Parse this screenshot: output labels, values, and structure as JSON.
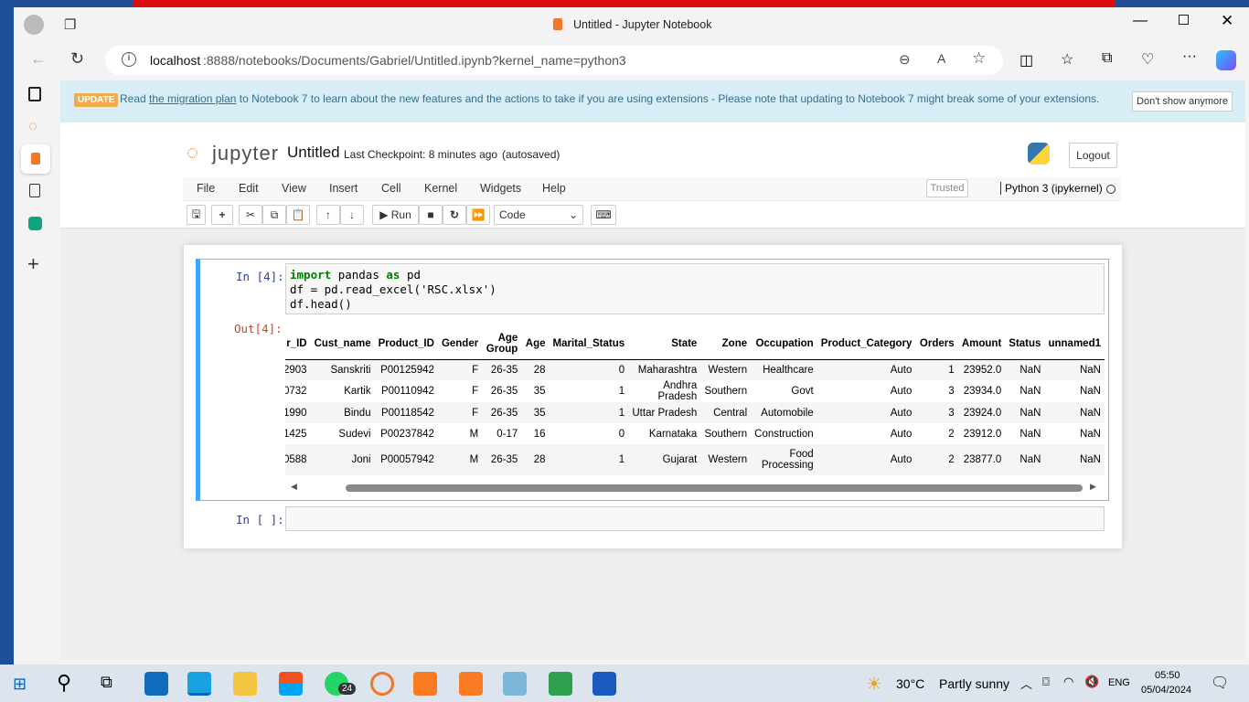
{
  "browser": {
    "tab_title": "Untitled - Jupyter Notebook",
    "url_host": "localhost",
    "url_rest": ":8888/notebooks/Documents/Gabriel/Untitled.ipynb?kernel_name=python3"
  },
  "banner": {
    "badge": "UPDATE",
    "pre": "Read ",
    "link": "the migration plan",
    "post": " to Notebook 7 to learn about the new features and the actions to take if you are using extensions - Please note that updating to Notebook 7 might break some of your extensions.",
    "dismiss": "Don't show anymore"
  },
  "header": {
    "logo": "jupyter",
    "title": "Untitled",
    "checkpoint": "Last Checkpoint: 8 minutes ago",
    "autosaved": "(autosaved)",
    "logout": "Logout",
    "trusted": "Trusted",
    "kernel": "Python 3 (ipykernel)"
  },
  "menu": [
    "File",
    "Edit",
    "View",
    "Insert",
    "Cell",
    "Kernel",
    "Widgets",
    "Help"
  ],
  "toolbar": {
    "run": "Run",
    "cell_type": "Code"
  },
  "cell1": {
    "prompt_in": "In [4]:",
    "prompt_out": "Out[4]:",
    "code": [
      [
        "import",
        "pandas",
        "as",
        "pd"
      ],
      "df = pd.read_excel('RSC.xlsx')",
      "df.head()"
    ]
  },
  "table": {
    "headers": [
      "r_ID",
      "Cust_name",
      "Product_ID",
      "Gender",
      "Age Group",
      "Age",
      "Marital_Status",
      "State",
      "Zone",
      "Occupation",
      "Product_Category",
      "Orders",
      "Amount",
      "Status",
      "unnamed1"
    ],
    "rows": [
      [
        "2903",
        "Sanskriti",
        "P00125942",
        "F",
        "26-35",
        "28",
        "0",
        "Maharashtra",
        "Western",
        "Healthcare",
        "Auto",
        "1",
        "23952.0",
        "NaN",
        "NaN"
      ],
      [
        "0732",
        "Kartik",
        "P00110942",
        "F",
        "26-35",
        "35",
        "1",
        "Andhra Pradesh",
        "Southern",
        "Govt",
        "Auto",
        "3",
        "23934.0",
        "NaN",
        "NaN"
      ],
      [
        "1990",
        "Bindu",
        "P00118542",
        "F",
        "26-35",
        "35",
        "1",
        "Uttar Pradesh",
        "Central",
        "Automobile",
        "Auto",
        "3",
        "23924.0",
        "NaN",
        "NaN"
      ],
      [
        "1425",
        "Sudevi",
        "P00237842",
        "M",
        "0-17",
        "16",
        "0",
        "Karnataka",
        "Southern",
        "Construction",
        "Auto",
        "2",
        "23912.0",
        "NaN",
        "NaN"
      ],
      [
        "0588",
        "Joni",
        "P00057942",
        "M",
        "26-35",
        "28",
        "1",
        "Gujarat",
        "Western",
        "Food Processing",
        "Auto",
        "2",
        "23877.0",
        "NaN",
        "NaN"
      ]
    ]
  },
  "cell2": {
    "prompt_in": "In [ ]:"
  },
  "taskbar": {
    "weather_temp": "30°C",
    "weather_text": "Partly sunny",
    "lang": "ENG",
    "time": "05:50",
    "date": "05/04/2024",
    "badge": "24"
  },
  "colors": {
    "accent": "#f37726",
    "banner_bg": "#d9edf7",
    "update_badge": "#f0ad4e",
    "selected_cell": "#42a5f5"
  }
}
